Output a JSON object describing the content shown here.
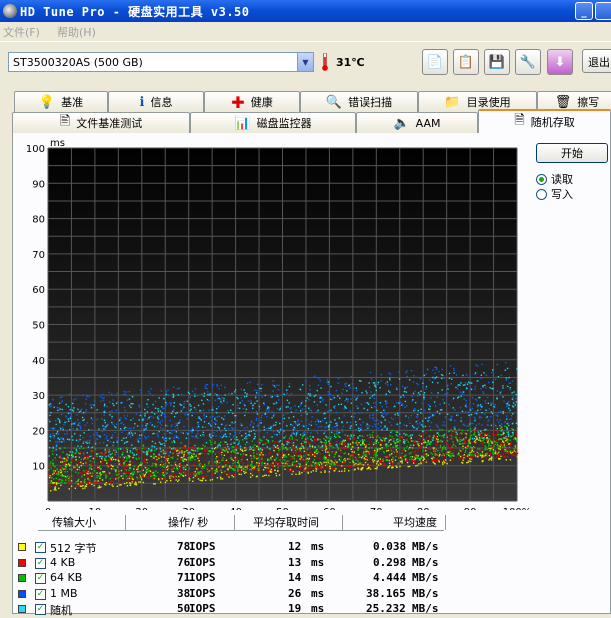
{
  "window": {
    "title": "HD Tune Pro - 硬盘实用工具 v3.50",
    "min_glyph": "_"
  },
  "menu": {
    "items": [
      "文件(F)",
      "帮助(H)"
    ]
  },
  "toolbar": {
    "drive": "ST3500320AS (500 GB)",
    "temperature": "31℃",
    "exit_label": "退出",
    "buttons": [
      "copy-text-icon",
      "copy-info-icon",
      "save-icon",
      "options-icon",
      "download-icon"
    ]
  },
  "tabs_row1": [
    {
      "label": "基准",
      "icon": "benchmark-icon"
    },
    {
      "label": "信息",
      "icon": "info-icon"
    },
    {
      "label": "健康",
      "icon": "health-icon"
    },
    {
      "label": "错误扫描",
      "icon": "error-scan-icon"
    },
    {
      "label": "目录使用",
      "icon": "folder-usage-icon"
    },
    {
      "label": "擦写",
      "icon": "erase-icon"
    }
  ],
  "tabs_row2": [
    {
      "label": "文件基准测试",
      "icon": "file-benchmark-icon"
    },
    {
      "label": "磁盘监控器",
      "icon": "disk-monitor-icon"
    },
    {
      "label": "AAM",
      "icon": "speaker-icon"
    },
    {
      "label": "随机存取",
      "icon": "random-access-icon",
      "active": true
    }
  ],
  "controls": {
    "start_label": "开始",
    "radio_read": "读取",
    "radio_write": "写入",
    "selected": "read"
  },
  "chart_data": {
    "type": "scatter",
    "ylabel": "ms",
    "ylim": [
      0,
      100
    ],
    "xlim": [
      0,
      100
    ],
    "x_unit": "%",
    "y_ticks": [
      "100",
      "90",
      "80",
      "70",
      "60",
      "50",
      "40",
      "30",
      "20",
      "10"
    ],
    "x_ticks": [
      "0",
      "10",
      "20",
      "30",
      "40",
      "50",
      "60",
      "70",
      "80",
      "90",
      "100%"
    ],
    "background": "#000000",
    "grid": true,
    "series": [
      {
        "name": "512 字节",
        "color": "#e8e800",
        "y_min_start": 3,
        "y_min_end": 12,
        "y_max_start": 13,
        "y_max_end": 20
      },
      {
        "name": "4 KB",
        "color": "#e80000",
        "y_min_start": 4,
        "y_min_end": 13,
        "y_max_start": 14,
        "y_max_end": 21
      },
      {
        "name": "64 KB",
        "color": "#00c800",
        "y_min_start": 5,
        "y_min_end": 14,
        "y_max_start": 15,
        "y_max_end": 22
      },
      {
        "name": "1 MB",
        "color": "#1060f0",
        "y_min_start": 16,
        "y_min_end": 22,
        "y_max_start": 30,
        "y_max_end": 40
      },
      {
        "name": "随机",
        "color": "#20d8e8",
        "y_min_start": 12,
        "y_min_end": 18,
        "y_max_start": 28,
        "y_max_end": 38
      }
    ]
  },
  "results": {
    "headers": [
      "传输大小",
      "操作/ 秒",
      "平均存取时间",
      "平均速度"
    ],
    "rows": [
      {
        "name": "512 字节",
        "color": "#ffff00",
        "ops": "78",
        "ops_unit": "IOPS",
        "time": "12",
        "time_unit": "ms",
        "speed": "0.038",
        "speed_unit": "MB/s"
      },
      {
        "name": "4 KB",
        "color": "#ff0000",
        "ops": "76",
        "ops_unit": "IOPS",
        "time": "13",
        "time_unit": "ms",
        "speed": "0.298",
        "speed_unit": "MB/s"
      },
      {
        "name": "64 KB",
        "color": "#00c000",
        "ops": "71",
        "ops_unit": "IOPS",
        "time": "14",
        "time_unit": "ms",
        "speed": "4.444",
        "speed_unit": "MB/s"
      },
      {
        "name": "1 MB",
        "color": "#0050ff",
        "ops": "38",
        "ops_unit": "IOPS",
        "time": "26",
        "time_unit": "ms",
        "speed": "38.165",
        "speed_unit": "MB/s"
      },
      {
        "name": "随机",
        "color": "#20e0f0",
        "ops": "50",
        "ops_unit": "IOPS",
        "time": "19",
        "time_unit": "ms",
        "speed": "25.232",
        "speed_unit": "MB/s"
      }
    ]
  }
}
